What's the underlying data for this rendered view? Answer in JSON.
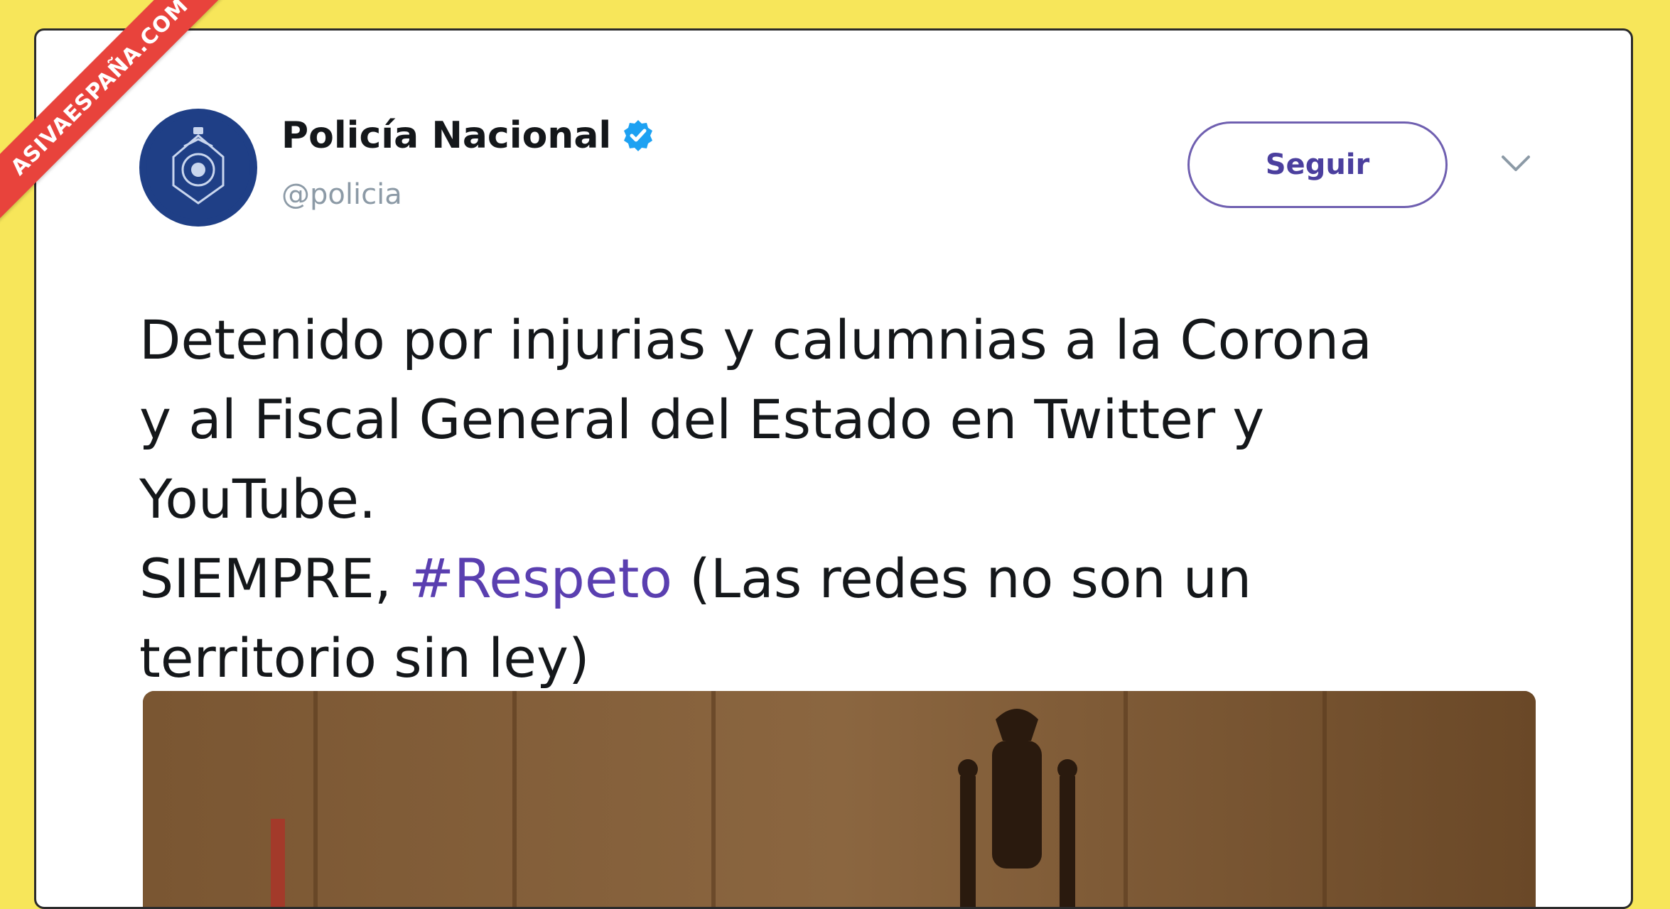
{
  "watermark": {
    "text": "ASIVAESPAÑA.COM"
  },
  "tweet": {
    "author_name": "Policía Nacional",
    "author_handle": "@policia",
    "verified_icon": "verified-badge-icon",
    "follow_label": "Seguir",
    "menu_icon": "chevron-down-icon",
    "text_lines": [
      "Detenido por injurias y calumnias a la Corona",
      "y al Fiscal General del Estado en Twitter y",
      "YouTube."
    ],
    "line4_prefix": "SIEMPRE, ",
    "hashtag": "#Respeto",
    "line4_suffix": " (Las redes no son un",
    "line5": "territorio sin ley)"
  },
  "colors": {
    "background": "#f7e65a",
    "hashtag": "#5a3fb0",
    "follow_border": "#6f5fb0",
    "ribbon": "#e8433c"
  }
}
